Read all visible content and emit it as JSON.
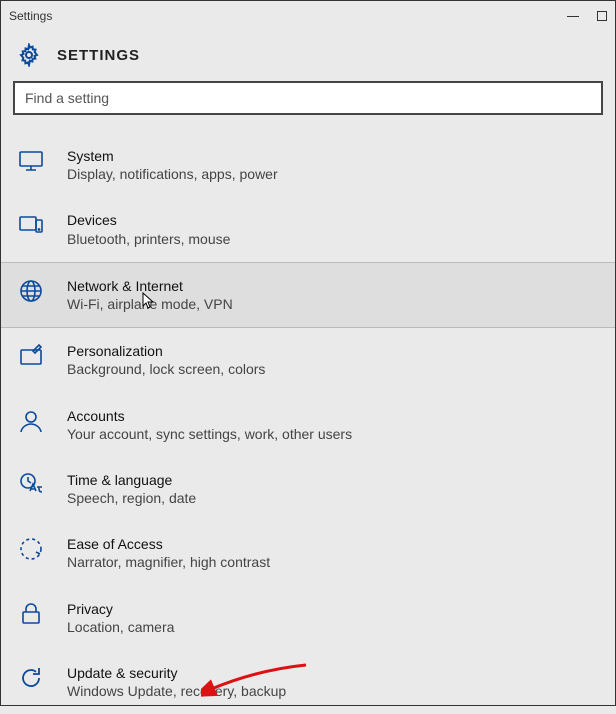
{
  "window": {
    "title": "Settings"
  },
  "header": {
    "title": "SETTINGS"
  },
  "search": {
    "placeholder": "Find a setting"
  },
  "categories": [
    {
      "id": "system",
      "icon": "system-icon",
      "title": "System",
      "desc": "Display, notifications, apps, power"
    },
    {
      "id": "devices",
      "icon": "devices-icon",
      "title": "Devices",
      "desc": "Bluetooth, printers, mouse"
    },
    {
      "id": "network",
      "icon": "network-icon",
      "title": "Network & Internet",
      "desc": "Wi-Fi, airplane mode, VPN"
    },
    {
      "id": "personalization",
      "icon": "personalization-icon",
      "title": "Personalization",
      "desc": "Background, lock screen, colors"
    },
    {
      "id": "accounts",
      "icon": "accounts-icon",
      "title": "Accounts",
      "desc": "Your account, sync settings, work, other users"
    },
    {
      "id": "time-language",
      "icon": "time-language-icon",
      "title": "Time & language",
      "desc": "Speech, region, date"
    },
    {
      "id": "ease-of-access",
      "icon": "ease-of-access-icon",
      "title": "Ease of Access",
      "desc": "Narrator, magnifier, high contrast"
    },
    {
      "id": "privacy",
      "icon": "privacy-icon",
      "title": "Privacy",
      "desc": "Location, camera"
    },
    {
      "id": "update-security",
      "icon": "update-security-icon",
      "title": "Update & security",
      "desc": "Windows Update, recovery, backup"
    }
  ]
}
